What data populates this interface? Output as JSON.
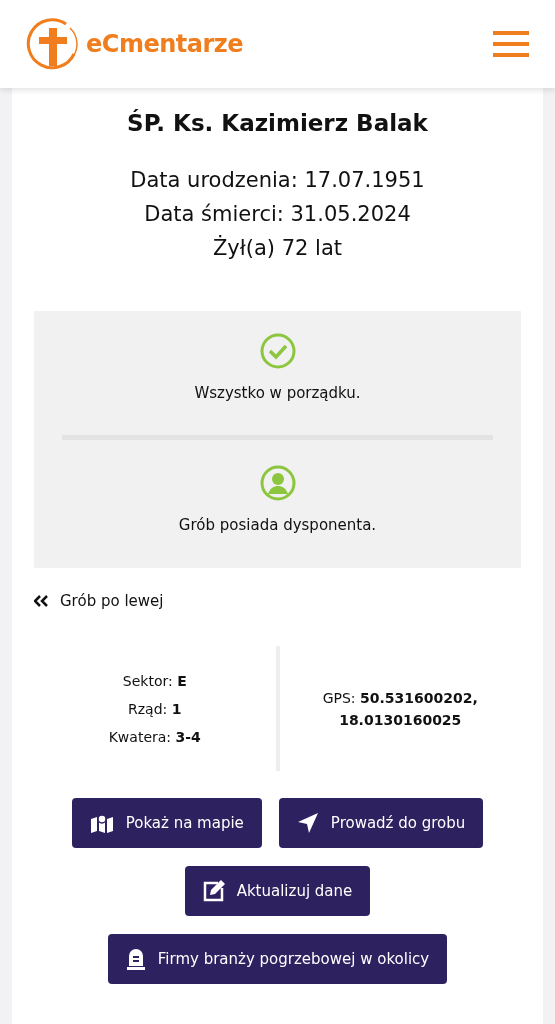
{
  "header": {
    "logo_text": "eCmentarze"
  },
  "person": {
    "name": "ŚP. Ks. Kazimierz Balak",
    "details": [
      "Data urodzenia: 17.07.1951",
      "Data śmierci: 31.05.2024",
      "Żył(a) 72 lat"
    ]
  },
  "status": [
    {
      "kind": "ok",
      "text": "Wszystko w porządku."
    },
    {
      "kind": "owner",
      "text": "Grób posiada dysponenta."
    }
  ],
  "nav_link": "Grób po lewej",
  "location": [
    "Sektor: **E**",
    "Rząd: **1**",
    "Kwatera: **3-4**"
  ],
  "gps": "GPS: **50.531600202, 18.0130160025**",
  "button_rows": [
    [
      {
        "kind": "map",
        "label": "Pokaż na mapie"
      },
      {
        "kind": "navigate",
        "label": "Prowadź do grobu"
      }
    ],
    [
      {
        "kind": "edit",
        "label": "Aktualizuj dane"
      }
    ],
    [
      {
        "kind": "tombstone",
        "label": "Firmy branży pogrzebowej w okolicy"
      }
    ]
  ]
}
